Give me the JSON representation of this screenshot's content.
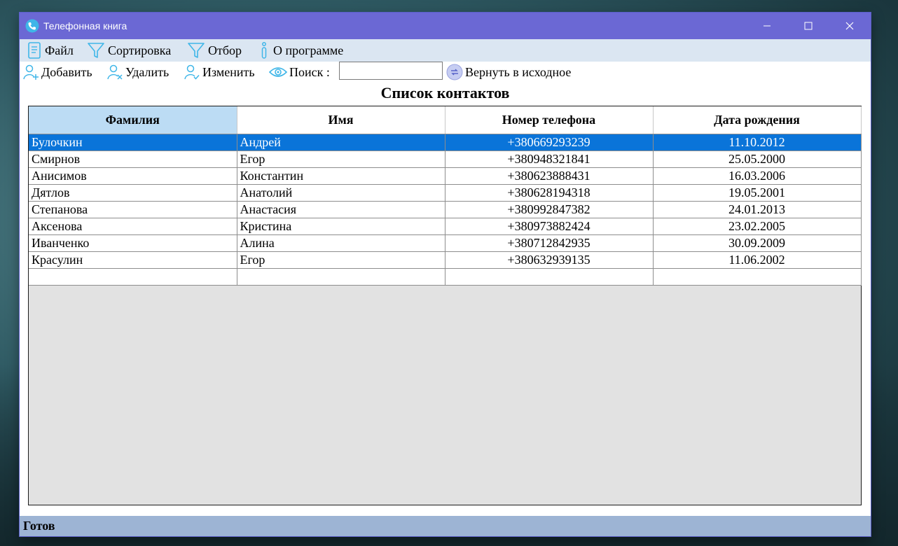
{
  "window": {
    "title": "Телефонная книга"
  },
  "menu": {
    "file": "Файл",
    "sort": "Сортировка",
    "filter": "Отбор",
    "about": "О программе"
  },
  "toolbar": {
    "add": "Добавить",
    "delete": "Удалить",
    "edit": "Изменить",
    "search_label": "Поиск :",
    "search_value": "",
    "reset": "Вернуть в исходное"
  },
  "heading": "Список контактов",
  "table": {
    "columns": [
      "Фамилия",
      "Имя",
      "Номер телефона",
      "Дата рождения"
    ],
    "rows": [
      [
        "Булочкин",
        "Андрей",
        "+380669293239",
        "11.10.2012"
      ],
      [
        "Смирнов",
        "Егор",
        "+380948321841",
        "25.05.2000"
      ],
      [
        "Анисимов",
        "Константин",
        "+380623888431",
        "16.03.2006"
      ],
      [
        "Дятлов",
        "Анатолий",
        "+380628194318",
        "19.05.2001"
      ],
      [
        "Степанова",
        "Анастасия",
        "+380992847382",
        "24.01.2013"
      ],
      [
        "Аксенова",
        "Кристина",
        "+380973882424",
        "23.02.2005"
      ],
      [
        "Иванченко",
        "Алина",
        "+380712842935",
        "30.09.2009"
      ],
      [
        "Красулин",
        "Егор",
        "+380632939135",
        "11.06.2002"
      ],
      [
        "",
        "",
        "",
        ""
      ]
    ]
  },
  "status": "Готов",
  "colors": {
    "titlebar": "#6b68d4",
    "menubar": "#dbe6f2",
    "selected_row": "#0a74d9",
    "selected_header": "#bcdcf4",
    "statusbar": "#9db4d4",
    "icon": "#3fb6e8"
  }
}
